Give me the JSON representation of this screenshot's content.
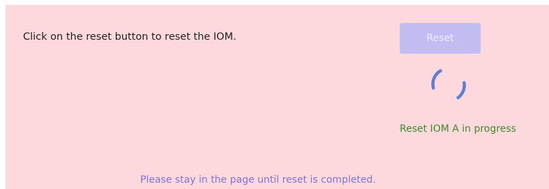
{
  "panel": {
    "instruction": "Click on the reset button to reset the IOM.",
    "reset_button_label": "Reset",
    "reset_button_state": "disabled",
    "spinner_icon": "loading-spinner-icon",
    "status_text": "Reset IOM A in progress",
    "notice_text": "Please stay in the page until reset is completed."
  },
  "colors": {
    "panel_background": "#fdd9dd",
    "button_background": "#c1bdf2",
    "spinner": "#5b7fd6",
    "status": "#3e8a2a",
    "notice": "#7e73d6"
  }
}
